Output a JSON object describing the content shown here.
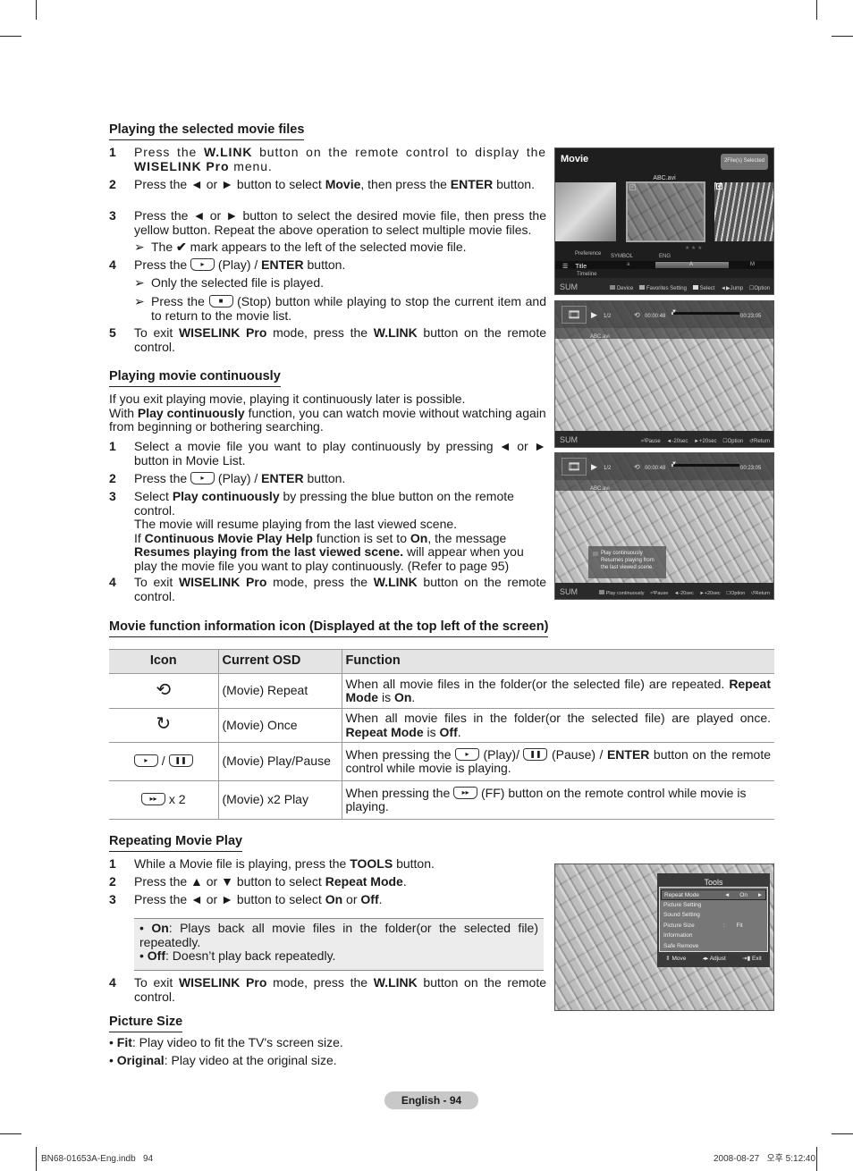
{
  "sections": {
    "playing_selected": {
      "title": "Playing the selected movie files",
      "steps": [
        {
          "num": "1",
          "html": "Press the <b>W.LINK</b> button on the remote control to display the <b>WISELINK Pro</b> menu."
        },
        {
          "num": "2",
          "html": "Press the ◄ or ► button to select <b>Movie</b>, then press the <b>ENTER</b> button."
        },
        {
          "num": "3",
          "html": "Press the ◄ or ► button to select the desired movie file, then press the yellow button. Repeat the above operation to select multiple movie files."
        },
        {
          "num": "4",
          "html": "Press the <span class=\"btnicon\" data-glyph=\"▸\"></span> (Play) / <b>ENTER</b> button."
        },
        {
          "num": "5",
          "html": "To exit <b>WISELINK Pro</b> mode, press the <b>W.LINK</b> button on the remote control."
        }
      ],
      "notes": [
        {
          "arrow": "➢",
          "html": "The <b>✔</b> mark appears to the left of the selected movie file."
        },
        {
          "arrow": "➢",
          "html": "Only the selected file is played."
        },
        {
          "arrow": "➢",
          "html": "Press the <span class=\"btnicon\" data-glyph=\"■\"></span> (Stop) button while playing to stop the current item and to return to the movie list."
        }
      ]
    },
    "continuous": {
      "title": "Playing movie continuously",
      "intro_html": "If you exit playing movie, playing it continuously later is possible.<br>With <b>Play continuously</b> function, you can watch movie without watching again from beginning or bothering searching.",
      "steps": [
        {
          "num": "1",
          "html": "Select a movie file you want to play continuously by pressing ◄ or ► button in Movie List."
        },
        {
          "num": "2",
          "html": "Press the <span class=\"btnicon\" data-glyph=\"▸\"></span> (Play) / <b>ENTER</b> button."
        },
        {
          "num": "3",
          "html": "Select <b>Play continuously</b> by pressing the blue button on the remote control.<br>The movie will resume playing from the last viewed scene.<br>If <b>Continuous Movie Play Help</b> function is set to <b>On</b>, the message <b>Resumes playing from the last viewed scene.</b> will appear when you play the movie file you want to play continuously. (Refer to page 95)"
        },
        {
          "num": "4",
          "html": "To exit <b>WISELINK Pro</b> mode, press the <b>W.LINK</b> button on the remote control."
        }
      ]
    },
    "info_icon": {
      "title": "Movie function information icon (Displayed at the top left of the screen)",
      "headers": [
        "Icon",
        "Current OSD",
        "Function"
      ],
      "rows": [
        {
          "icon": "repeat-icon",
          "icon_html": "<span style=\"font-size:20px\">⟲</span>",
          "osd": "(Movie) Repeat",
          "fn_html": "When all movie files in the folder(or the selected file) are repeated. <b>Repeat Mode</b> is <b>On</b>."
        },
        {
          "icon": "once-icon",
          "icon_html": "<span style=\"font-size:20px\">↻</span>",
          "osd": "(Movie) Once",
          "fn_html": "When all movie files in the folder(or the selected file) are played once. <b>Repeat Mode</b> is <b>Off</b>."
        },
        {
          "icon": "play-pause-icon",
          "icon_html": "<span class=\"btnicon\" data-glyph=\"▸\"></span> / <span class=\"btnicon\" data-glyph=\"❚❚\"></span>",
          "osd": "(Movie) Play/Pause",
          "fn_html": "When pressing the <span class=\"btnicon\" data-glyph=\"▸\"></span> (Play)/ <span class=\"btnicon\" data-glyph=\"❚❚\"></span> (Pause) / <b>ENTER</b> button on the remote control while movie is playing."
        },
        {
          "icon": "fast-forward-icon",
          "icon_html": "<span class=\"btnicon\" data-glyph=\"▸▸\"></span> x 2",
          "osd": "(Movie) x2 Play",
          "fn_html": "When pressing the <span class=\"btnicon\" data-glyph=\"▸▸\"></span> (FF) button on the remote control while movie is playing."
        }
      ]
    },
    "repeating": {
      "title": "Repeating Movie Play",
      "steps": [
        {
          "num": "1",
          "html": "While a Movie file is playing, press the <b>TOOLS</b> button."
        },
        {
          "num": "2",
          "html": "Press the ▲ or ▼ button to select <b>Repeat Mode</b>."
        },
        {
          "num": "3",
          "html": "Press the ◄ or ► button to select <b>On</b> or <b>Off</b>."
        },
        {
          "num": "4",
          "html": "To exit <b>WISELINK Pro</b> mode, press the <b>W.LINK</b> button on the remote control."
        }
      ],
      "box_html": "• <b>On</b>: Plays back all movie files in the folder(or the selected file) repeatedly.<br>• <b>Off</b>: Doesn’t play back repeatedly."
    },
    "picture_size": {
      "title": "Picture Size",
      "bullets_html": [
        "• <b>Fit</b>: Play video to fit the TV's screen size.",
        "• <b>Original</b>: Play video at the original size."
      ]
    }
  },
  "screens": {
    "movie_list": {
      "title": "Movie",
      "badge": "2File(s) Selected",
      "filename": "ABC.avi",
      "sort_labels": {
        "preference": "Preference",
        "title": "Title",
        "timeline": "Timeline",
        "symbol": "SYMBOL",
        "eng": "ENG",
        "sym_val": "a",
        "eng_val": "A",
        "eng_val2": "M"
      },
      "sum": "SUM",
      "legend": [
        "Device",
        "Favorites Setting",
        "Select",
        "Jump",
        "Option"
      ]
    },
    "player": {
      "count": "1/2",
      "time_now": "00:00:48",
      "time_total": "00:23:05",
      "progress": 0.03,
      "filename": "ABC.avi",
      "sum": "SUM",
      "legend": [
        "Pause",
        "-20sec",
        "+20sec",
        "Option",
        "Return"
      ]
    },
    "player_continue": {
      "count": "1/2",
      "time_now": "00:00:48",
      "time_total": "00:23:05",
      "filename": "ABC.avi",
      "popup": [
        "Play continuously",
        "Resumes playing from",
        "the last viewed scene."
      ],
      "sum": "SUM",
      "legend": [
        "Play continuously",
        "Pause",
        "-20sec",
        "+20sec",
        "Option",
        "Return"
      ]
    },
    "tools": {
      "title": "Tools",
      "items": [
        {
          "label": "Repeat Mode",
          "value": "On",
          "selected": true
        },
        {
          "label": "Picture Setting",
          "value": ""
        },
        {
          "label": "Sound Setting",
          "value": ""
        },
        {
          "label": "Picture Size",
          "value": "Fit"
        },
        {
          "label": "Information",
          "value": ""
        },
        {
          "label": "Safe Remove",
          "value": ""
        }
      ],
      "footer": [
        "Move",
        "Adjust",
        "Exit"
      ]
    }
  },
  "footer": {
    "page_label": "English - 94",
    "print_left": "BN68-01653A-Eng.indb   94",
    "print_right": "2008-08-27   오후 5:12:40"
  }
}
